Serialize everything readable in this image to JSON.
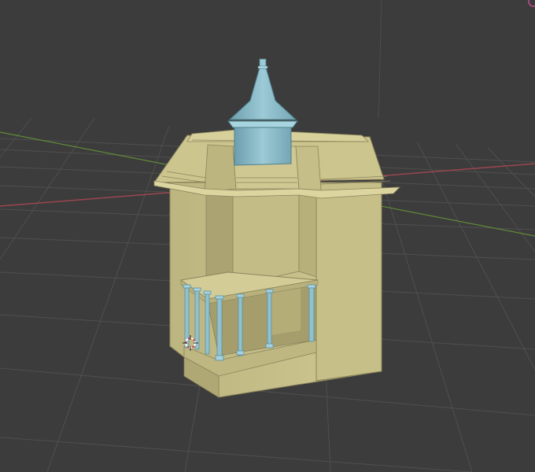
{
  "viewport": {
    "background": "#3c3c3c",
    "grid_color": "#4f4f4f",
    "x_axis_color": "#a84a55",
    "y_axis_color": "#6a9a3c"
  },
  "model": {
    "body_color": "#cbc38a",
    "body_shade_color": "#a89f6b",
    "roof_color": "#d2c992",
    "accent_color": "#8fc1cf",
    "accent_shade_color": "#6e9fae"
  },
  "gizmo": {
    "icon": "3d-cursor-icon"
  }
}
